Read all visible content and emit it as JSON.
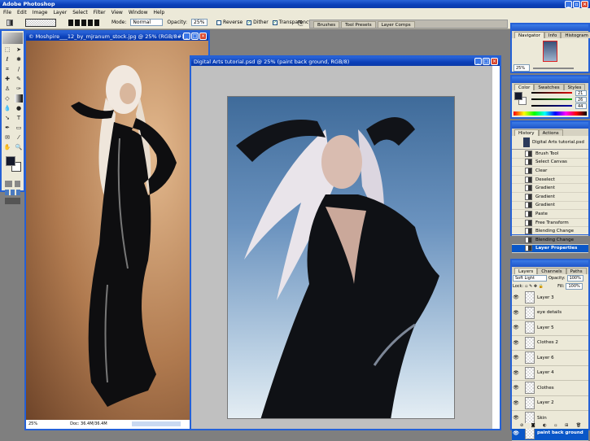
{
  "app": {
    "title": "Adobe Photoshop"
  },
  "menu": [
    "File",
    "Edit",
    "Image",
    "Layer",
    "Select",
    "Filter",
    "View",
    "Window",
    "Help"
  ],
  "options": {
    "mode_label": "Mode:",
    "mode_value": "Normal",
    "opacity_label": "Opacity:",
    "opacity_value": "25%",
    "reverse": "Reverse",
    "dither": "Dither",
    "transparency": "Transparency",
    "reverse_checked": false,
    "dither_checked": true,
    "transparency_checked": true
  },
  "palette_well": [
    "Brushes",
    "Tool Presets",
    "Layer Comps"
  ],
  "doc1": {
    "title": "© Moshpire___12_by_mjranum_stock.jpg @ 25% (RGB/8#)",
    "zoom": "25%",
    "doc": "Doc: 36.4M/36.4M"
  },
  "doc2": {
    "title": "Digital Arts tutorial.psd @ 25% (paint back ground, RGB/8)"
  },
  "navigator": {
    "tabs": [
      "Navigator",
      "Info",
      "Histogram"
    ],
    "zoom": "25%"
  },
  "color": {
    "tabs": [
      "Color",
      "Swatches",
      "Styles"
    ],
    "r": "21",
    "g": "26",
    "b": "44",
    "fg": "#151a2c"
  },
  "history": {
    "tabs": [
      "History",
      "Actions"
    ],
    "snapshot": "Digital Arts tutorial.psd",
    "items": [
      "Brush Tool",
      "Select Canvas",
      "Clear",
      "Deselect",
      "Gradient",
      "Gradient",
      "Gradient",
      "Paste",
      "Free Transform",
      "Blending Change",
      "Blending Change",
      "Layer Properties"
    ]
  },
  "layers": {
    "tabs": [
      "Layers",
      "Channels",
      "Paths"
    ],
    "blend": "Soft Light",
    "opacity_label": "Opacity:",
    "opacity": "100%",
    "lock_label": "Lock:",
    "fill_label": "Fill:",
    "fill": "100%",
    "items": [
      "Layer 3",
      "eye details",
      "Layer 5",
      "Clothes 2",
      "Layer 6",
      "Layer 4",
      "Clothes",
      "Layer 2",
      "Skin",
      "paint back ground"
    ]
  }
}
